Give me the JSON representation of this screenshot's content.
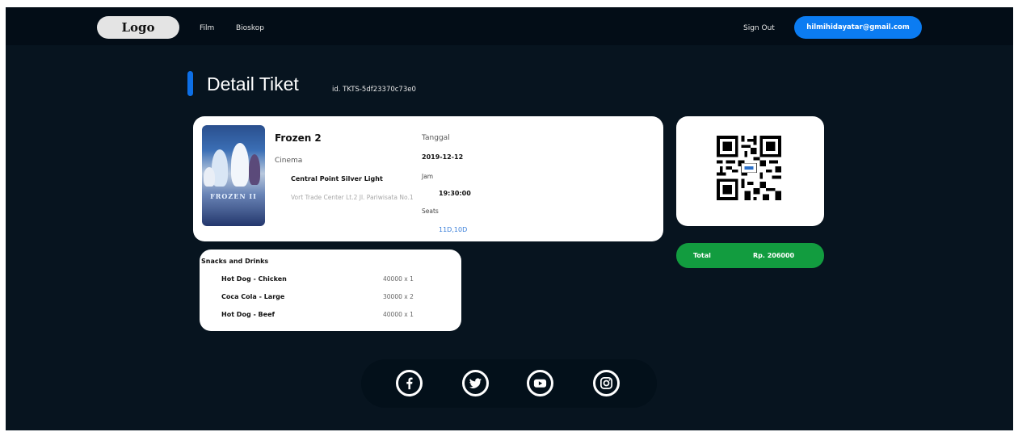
{
  "header": {
    "logo_label": "Logo",
    "nav": [
      "Film",
      "Bioskop"
    ],
    "sign_out_label": "Sign Out",
    "user_email": "hilmihidayatar@gmail.com"
  },
  "page": {
    "title": "Detail Tiket",
    "ticket_id": "id. TKTS-5df23370c73e0"
  },
  "ticket": {
    "movie_title": "Frozen 2",
    "poster_text": "FROZEN II",
    "cinema_label": "Cinema",
    "cinema_name": "Central Point Silver Light",
    "cinema_address": "Vort Trade Center Lt.2 Jl. Pariwisata No.1",
    "date_label": "Tanggal",
    "date_value": "2019-12-12",
    "time_label": "Jam",
    "time_value": "19:30:00",
    "seats_label": "Seats",
    "seats_value": "11D,10D"
  },
  "snacks": {
    "heading": "Snacks and Drinks",
    "items": [
      {
        "name": "Hot Dog - Chicken",
        "qty": "40000 x 1"
      },
      {
        "name": "Coca Cola - Large",
        "qty": "30000 x 2"
      },
      {
        "name": "Hot Dog - Beef",
        "qty": "40000 x 1"
      }
    ]
  },
  "total": {
    "label": "Total",
    "value": "Rp. 206000"
  },
  "social": [
    "facebook-icon",
    "twitter-icon",
    "youtube-icon",
    "instagram-icon"
  ],
  "colors": {
    "background": "#07141f",
    "topbar": "#030d17",
    "accent_blue": "#0b7cf2",
    "total_green": "#129c3f",
    "seat_blue": "#3a7fd9"
  }
}
